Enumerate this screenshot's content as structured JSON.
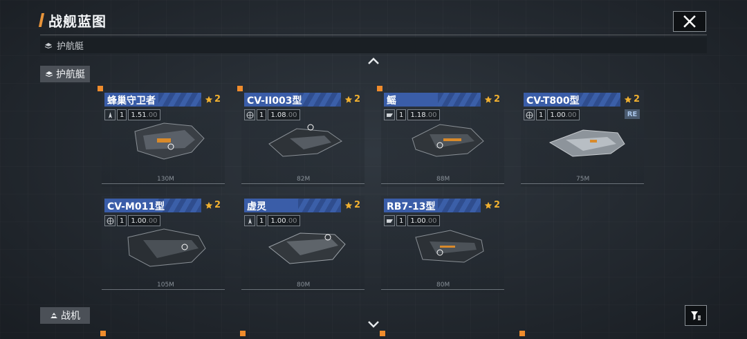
{
  "header": {
    "title": "战舰蓝图"
  },
  "section": {
    "label": "护航艇"
  },
  "category_top": {
    "label": "护航艇"
  },
  "category_bottom": {
    "label": "战机"
  },
  "ships": [
    {
      "name": "蜂巢守卫者",
      "stars": "2",
      "level": "1",
      "value": "1.51",
      "suffix": ".00",
      "length": "130M",
      "re": ""
    },
    {
      "name": "CV-II003型",
      "stars": "2",
      "level": "1",
      "value": "1.08",
      "suffix": ".00",
      "length": "82M",
      "re": ""
    },
    {
      "name": "鳐",
      "stars": "2",
      "level": "1",
      "value": "1.18",
      "suffix": ".00",
      "length": "88M",
      "re": ""
    },
    {
      "name": "CV-T800型",
      "stars": "2",
      "level": "1",
      "value": "1.00",
      "suffix": ".00",
      "length": "75M",
      "re": "RE"
    },
    {
      "name": "CV-M011型",
      "stars": "2",
      "level": "1",
      "value": "1.00",
      "suffix": ".00",
      "length": "105M",
      "re": ""
    },
    {
      "name": "虚灵",
      "stars": "2",
      "level": "1",
      "value": "1.00",
      "suffix": ".00",
      "length": "80M",
      "re": ""
    },
    {
      "name": "RB7-13型",
      "stars": "2",
      "level": "1",
      "value": "1.00",
      "suffix": ".00",
      "length": "80M",
      "re": ""
    }
  ],
  "colors": {
    "accent": "#f08c2c",
    "name_bar": "#3a5da8",
    "star": "#f0b030"
  },
  "icons": {
    "close": "close-icon",
    "filter": "filter-icon",
    "star": "star-badge-icon"
  }
}
